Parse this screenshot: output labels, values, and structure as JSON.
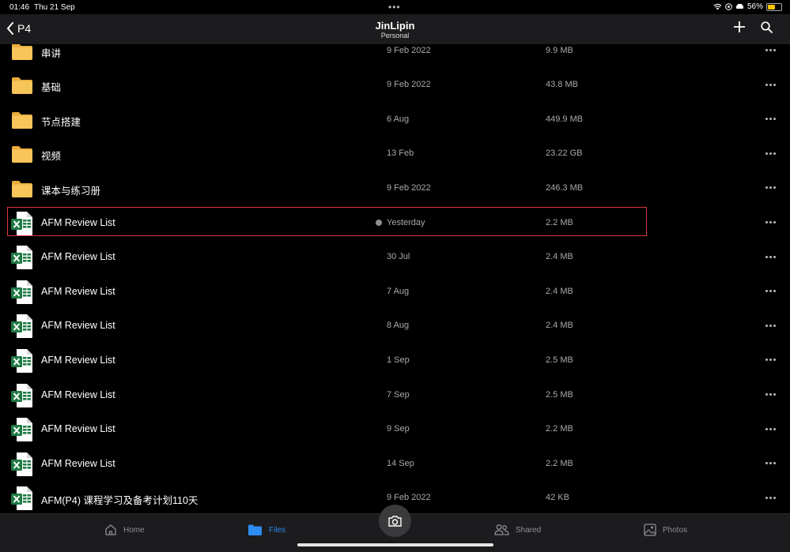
{
  "status": {
    "time": "01:46",
    "date": "Thu 21 Sep",
    "battery": "56%",
    "battery_level": 0.56
  },
  "nav": {
    "back_label": "P4",
    "title": "JinLipin",
    "subtitle": "Personal"
  },
  "files": [
    {
      "name": "串讲",
      "date": "9 Feb 2022",
      "size": "9.9 MB",
      "type": "folder"
    },
    {
      "name": "基础",
      "date": "9 Feb 2022",
      "size": "43.8 MB",
      "type": "folder"
    },
    {
      "name": "节点搭建",
      "date": "6 Aug",
      "size": "449.9 MB",
      "type": "folder"
    },
    {
      "name": "视频",
      "date": "13 Feb",
      "size": "23.22 GB",
      "type": "folder"
    },
    {
      "name": "课本与练习册",
      "date": "9 Feb 2022",
      "size": "246.3 MB",
      "type": "folder"
    },
    {
      "name": "AFM Review List",
      "date": "Yesterday",
      "size": "2.2 MB",
      "type": "excel",
      "selected": true,
      "syncing": true
    },
    {
      "name": "AFM Review List",
      "date": "30 Jul",
      "size": "2.4 MB",
      "type": "excel"
    },
    {
      "name": "AFM Review List",
      "date": "7 Aug",
      "size": "2.4 MB",
      "type": "excel"
    },
    {
      "name": "AFM Review List",
      "date": "8 Aug",
      "size": "2.4 MB",
      "type": "excel"
    },
    {
      "name": "AFM Review List",
      "date": "1 Sep",
      "size": "2.5 MB",
      "type": "excel"
    },
    {
      "name": "AFM Review List",
      "date": "7 Sep",
      "size": "2.5 MB",
      "type": "excel"
    },
    {
      "name": "AFM Review List",
      "date": "9 Sep",
      "size": "2.2 MB",
      "type": "excel"
    },
    {
      "name": "AFM Review List",
      "date": "14 Sep",
      "size": "2.2 MB",
      "type": "excel"
    },
    {
      "name": "AFM(P4) 课程学习及备考计划110天",
      "date": "9 Feb 2022",
      "size": "42 KB",
      "type": "excel"
    }
  ],
  "tabs": {
    "home": "Home",
    "files": "Files",
    "shared": "Shared",
    "photos": "Photos",
    "active": "files"
  },
  "colors": {
    "accent": "#2d8cf0",
    "folder": "#f7c55a",
    "excel": "#1e7a43",
    "highlight": "#d9363e"
  }
}
